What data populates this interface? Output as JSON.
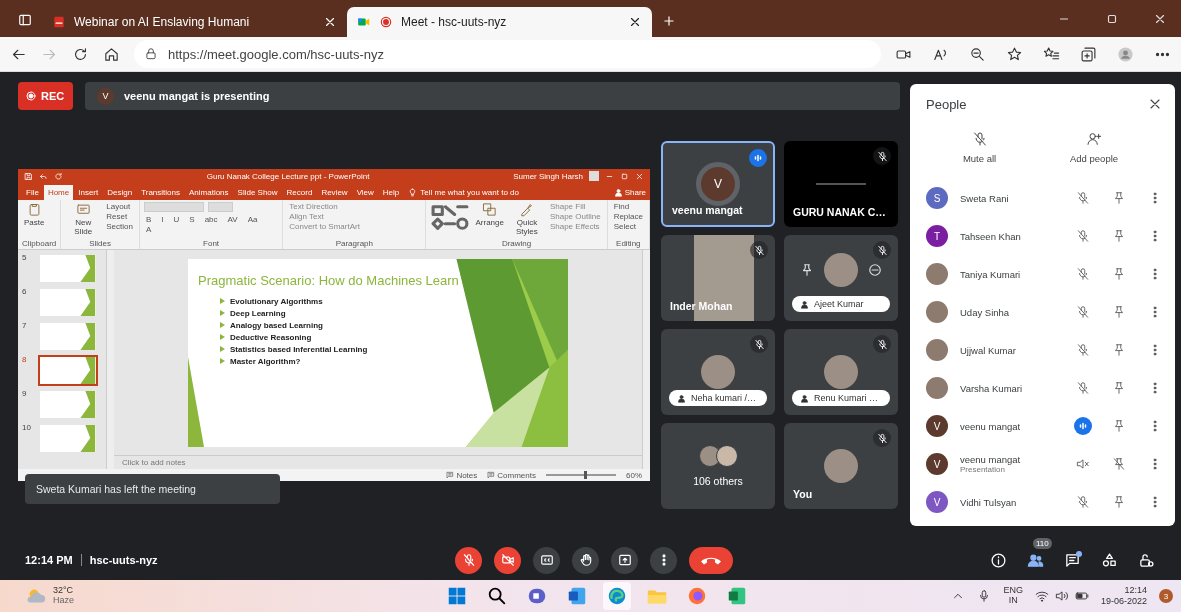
{
  "browser": {
    "tabs": [
      {
        "kind": "pdf",
        "title": "Webinar on AI Enslaving Humani",
        "selected": false,
        "recording": false
      },
      {
        "kind": "meet",
        "title": "Meet - hsc-uuts-nyz",
        "selected": true,
        "recording": true
      }
    ],
    "url": "https://meet.google.com/hsc-uuts-nyz"
  },
  "meeting": {
    "rec_label": "REC",
    "presenter_initial": "V",
    "presenting_text": "veenu mangat is presenting",
    "toast": "Sweta Kumari has left the meeting"
  },
  "presentation": {
    "app_title": "Guru Nanak College Lecture ppt  -  PowerPoint",
    "user": "Sumer Singh Harsh",
    "tabs": [
      {
        "label": "File",
        "selected": false
      },
      {
        "label": "Home",
        "selected": true
      },
      {
        "label": "Insert",
        "selected": false
      },
      {
        "label": "Design",
        "selected": false
      },
      {
        "label": "Transitions",
        "selected": false
      },
      {
        "label": "Animations",
        "selected": false
      },
      {
        "label": "Slide Show",
        "selected": false
      },
      {
        "label": "Record",
        "selected": false
      },
      {
        "label": "Review",
        "selected": false
      },
      {
        "label": "View",
        "selected": false
      },
      {
        "label": "Help",
        "selected": false
      }
    ],
    "tell_me": "Tell me what you want to do",
    "share": "Share",
    "groups": [
      {
        "kind": "clipboard",
        "name": "Clipboard",
        "big": [
          "Paste"
        ]
      },
      {
        "kind": "slides",
        "name": "Slides",
        "big": [
          "New Slide"
        ],
        "items": [
          "Layout",
          "Reset",
          "Section"
        ]
      },
      {
        "kind": "font",
        "name": "Font",
        "items": [
          "B",
          "I",
          "U",
          "S",
          "abc",
          "AV",
          "Aa",
          "A"
        ]
      },
      {
        "kind": "paragraph",
        "name": "Paragraph",
        "items": [
          "Text Direction",
          "Align Text",
          "Convert to SmartArt"
        ]
      },
      {
        "kind": "drawing",
        "name": "Drawing",
        "big": [
          "Arrange",
          "Quick Styles"
        ],
        "items": [
          "Shape Fill",
          "Shape Outline",
          "Shape Effects"
        ]
      },
      {
        "kind": "editing",
        "name": "Editing",
        "items": [
          "Find",
          "Replace",
          "Select"
        ]
      }
    ],
    "thumbnails": [
      {
        "number": "5",
        "selected": false
      },
      {
        "number": "6",
        "selected": false
      },
      {
        "number": "7",
        "selected": false
      },
      {
        "number": "8",
        "selected": true
      },
      {
        "number": "9",
        "selected": false
      },
      {
        "number": "10",
        "selected": false
      }
    ],
    "slide": {
      "title": "Pragmatic Scenario: How do Machines Learn",
      "bullets": [
        "Evolutionary Algorithms",
        "Deep Learning",
        "Analogy based Learning",
        "Deductive Reasoning",
        "Statistics based Inferential Learning",
        "Master Algorithm?"
      ]
    },
    "notes_placeholder": "Click to add notes",
    "status": [
      "Notes",
      "Comments"
    ],
    "zoom_slider": {
      "level": 0.55
    },
    "zoom": "60%"
  },
  "tiles": [
    {
      "kind": "avatar",
      "name": "veenu mangat",
      "initial": "V",
      "name_chip": false,
      "highlighted": true,
      "speaking": true,
      "muted": false,
      "hover_controls": false
    },
    {
      "kind": "screen",
      "name": "GURU NANAK C…",
      "name_chip": false,
      "highlighted": false,
      "speaking": false,
      "muted": true,
      "hover_controls": false
    },
    {
      "kind": "video",
      "name": "Inder Mohan",
      "name_chip": false,
      "highlighted": false,
      "speaking": false,
      "muted": true,
      "hover_controls": false
    },
    {
      "kind": "photo",
      "name": "Ajeet Kumar",
      "name_chip": true,
      "highlighted": false,
      "speaking": false,
      "muted": true,
      "hover_controls": true
    },
    {
      "kind": "photo",
      "name": "Neha kumari /…",
      "name_chip": true,
      "highlighted": false,
      "speaking": false,
      "muted": true,
      "hover_controls": false
    },
    {
      "kind": "photo",
      "name": "Renu Kumari …",
      "name_chip": true,
      "highlighted": false,
      "speaking": false,
      "muted": true,
      "hover_controls": false
    },
    {
      "kind": "others",
      "name": "106 others",
      "name_chip": false,
      "highlighted": false,
      "speaking": false,
      "muted": false,
      "hover_controls": false
    },
    {
      "kind": "photo",
      "name": "You",
      "name_chip": false,
      "highlighted": false,
      "speaking": false,
      "muted": true,
      "hover_controls": false
    }
  ],
  "people_panel": {
    "title": "People",
    "actions": [
      {
        "kind": "mute",
        "label": "Mute all"
      },
      {
        "kind": "add",
        "label": "Add people"
      }
    ],
    "people": [
      {
        "kind": "initial",
        "name": "Sweta Rani",
        "initial": "S",
        "color": "#5c6bc0",
        "muted": true,
        "speaking": false,
        "audio_off": false,
        "pin_disabled": false
      },
      {
        "kind": "initial",
        "name": "Tahseen Khan",
        "initial": "T",
        "color": "#7b1fa2",
        "muted": true,
        "speaking": false,
        "audio_off": false,
        "pin_disabled": false
      },
      {
        "kind": "photo",
        "name": "Taniya Kumari",
        "muted": true,
        "speaking": false,
        "audio_off": false,
        "pin_disabled": false
      },
      {
        "kind": "photo",
        "name": "Uday Sinha",
        "muted": true,
        "speaking": false,
        "audio_off": false,
        "pin_disabled": false
      },
      {
        "kind": "photo",
        "name": "Ujjwal Kumar",
        "muted": true,
        "speaking": false,
        "audio_off": false,
        "pin_disabled": false
      },
      {
        "kind": "photo",
        "name": "Varsha Kumari",
        "muted": true,
        "speaking": false,
        "audio_off": false,
        "pin_disabled": false
      },
      {
        "kind": "initial",
        "name": "veenu mangat",
        "initial": "V",
        "color": "#5d3a2e",
        "muted": false,
        "speaking": true,
        "audio_off": false,
        "pin_disabled": false
      },
      {
        "kind": "initial",
        "name": "veenu mangat",
        "subtitle": "Presentation",
        "initial": "V",
        "color": "#5d3a2e",
        "muted": false,
        "speaking": false,
        "audio_off": true,
        "pin_disabled": true
      },
      {
        "kind": "initial",
        "name": "Vidhi Tulsyan",
        "initial": "V",
        "color": "#7e57c2",
        "muted": true,
        "speaking": false,
        "audio_off": false,
        "pin_disabled": false
      }
    ]
  },
  "call_bar": {
    "time": "12:14 PM",
    "code": "hsc-uuts-nyz",
    "controls": [
      {
        "kind": "mic",
        "off": true
      },
      {
        "kind": "camera",
        "off": true
      },
      {
        "kind": "captions",
        "off": false
      },
      {
        "kind": "hand",
        "off": false
      },
      {
        "kind": "present",
        "off": false
      },
      {
        "kind": "more",
        "off": false
      },
      {
        "kind": "hangup",
        "off": false
      }
    ],
    "side": [
      {
        "kind": "info",
        "selected": false
      },
      {
        "kind": "people",
        "selected": true,
        "badge": "110"
      },
      {
        "kind": "chat",
        "selected": false,
        "dot": true
      },
      {
        "kind": "activities",
        "selected": false
      },
      {
        "kind": "host",
        "selected": false
      }
    ]
  },
  "taskbar": {
    "weather": {
      "temp": "32°C",
      "condition": "Haze"
    },
    "apps": [
      {
        "kind": "start",
        "selected": false
      },
      {
        "kind": "search",
        "selected": false
      },
      {
        "kind": "meet",
        "selected": false
      },
      {
        "kind": "word",
        "selected": false
      },
      {
        "kind": "edge",
        "selected": true
      },
      {
        "kind": "explorer",
        "selected": false
      },
      {
        "kind": "firefox",
        "selected": false
      },
      {
        "kind": "excel",
        "selected": false
      }
    ],
    "tray": {
      "lang": "ENG",
      "region": "IN",
      "time": "12:14",
      "date": "19-06-2022",
      "notifications": "3"
    }
  }
}
